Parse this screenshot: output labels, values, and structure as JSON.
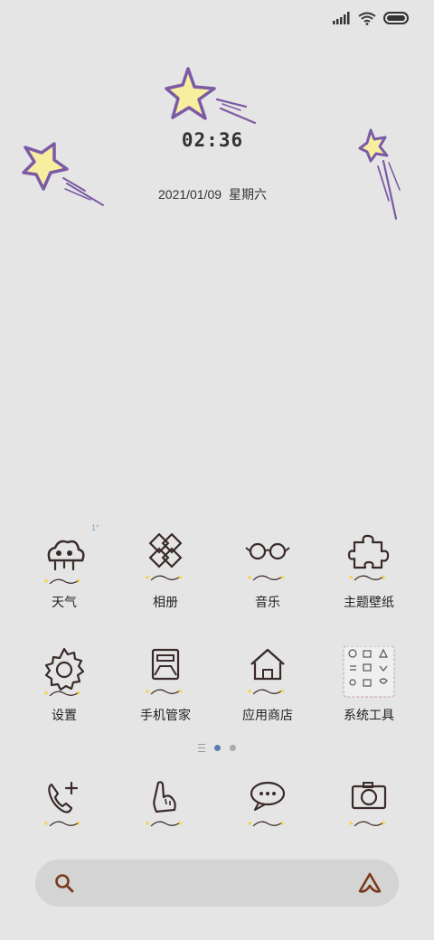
{
  "status_bar": {
    "icons": [
      "signal-icon",
      "wifi-icon",
      "battery-icon"
    ]
  },
  "lock": {
    "time": "02:36",
    "date": "2021/01/09",
    "weekday": "星期六"
  },
  "grid_note": "1°",
  "apps_row1": [
    {
      "label": "天气",
      "icon": "weather-cloud-icon"
    },
    {
      "label": "相册",
      "icon": "gallery-knot-icon"
    },
    {
      "label": "音乐",
      "icon": "glasses-music-icon"
    },
    {
      "label": "主题壁纸",
      "icon": "puzzle-theme-icon"
    }
  ],
  "apps_row2": [
    {
      "label": "设置",
      "icon": "gear-icon"
    },
    {
      "label": "手机管家",
      "icon": "phone-manager-icon"
    },
    {
      "label": "应用商店",
      "icon": "house-store-icon"
    },
    {
      "label": "系统工具",
      "icon": "folder-tools-icon"
    }
  ],
  "dock": [
    {
      "icon": "phone-add-icon"
    },
    {
      "icon": "hand-pointer-icon"
    },
    {
      "icon": "chat-bubble-icon"
    },
    {
      "icon": "camera-icon"
    }
  ],
  "page_indicator": {
    "current": 1,
    "total": 2
  },
  "colors": {
    "background": "#e5e5e5",
    "star_fill": "#f7ef9f",
    "star_stroke": "#7b5aa6",
    "icon_stroke": "#3a2a2a",
    "search_icon": "#7a3a1e",
    "dot_active": "#5b7fb0"
  }
}
